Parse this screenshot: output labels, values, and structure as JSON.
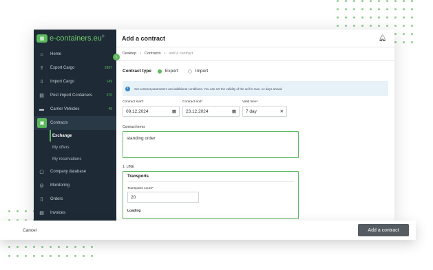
{
  "brand": {
    "name": "e-containers.eu",
    "reg": "®"
  },
  "sidebar": {
    "items": [
      {
        "label": "Home",
        "icon": "home-icon",
        "glyph": "⌂",
        "count": ""
      },
      {
        "label": "Export Cargo",
        "icon": "export-icon",
        "glyph": "⇪",
        "count": "2897"
      },
      {
        "label": "Import Cargo",
        "icon": "import-icon",
        "glyph": "⇩",
        "count": "149"
      },
      {
        "label": "Post import Containers",
        "icon": "container-icon",
        "glyph": "▤",
        "count": "370"
      },
      {
        "label": "Carrier Vehicles",
        "icon": "truck-icon",
        "glyph": "▬",
        "count": "46"
      },
      {
        "label": "Contracts",
        "icon": "document-icon",
        "glyph": "▣",
        "count": ""
      }
    ],
    "sub": [
      "Exchange",
      "My offers",
      "My reservations"
    ],
    "items2": [
      {
        "label": "Company database",
        "icon": "briefcase-icon",
        "glyph": "▢"
      },
      {
        "label": "Monitoring",
        "icon": "gauge-icon",
        "glyph": "◎"
      },
      {
        "label": "Orders",
        "icon": "clip-icon",
        "glyph": "▯"
      },
      {
        "label": "Invoices",
        "icon": "invoice-icon",
        "glyph": "▤"
      }
    ]
  },
  "header": {
    "title": "Add a contract"
  },
  "breadcrumb": [
    "Desktop",
    "Contracts",
    "add a contract"
  ],
  "form": {
    "type_label": "Contract type",
    "options": [
      "Export",
      "Import"
    ],
    "info": "Set contract parameters and additional conditions. You can set the validity of the ad for max. 14 days ahead.",
    "start_label": "Contract start*",
    "start_value": "09.12.2024",
    "end_label": "Contract end*",
    "end_value": "23.12.2024",
    "valid_label": "Valid time*",
    "valid_value": "7 day",
    "terms_label": "Contract terms",
    "terms_value": "standing order",
    "line_label": "1. LINE",
    "transports_title": "Transports",
    "transports_count_label": "Transports count*",
    "transports_count_value": "20",
    "loading_label": "Loading"
  },
  "footer": {
    "cancel": "Cancel",
    "submit": "Add a contract"
  },
  "colors": {
    "accent": "#5cb85c",
    "sidebar": "#1e2a35",
    "button": "#555c62"
  }
}
